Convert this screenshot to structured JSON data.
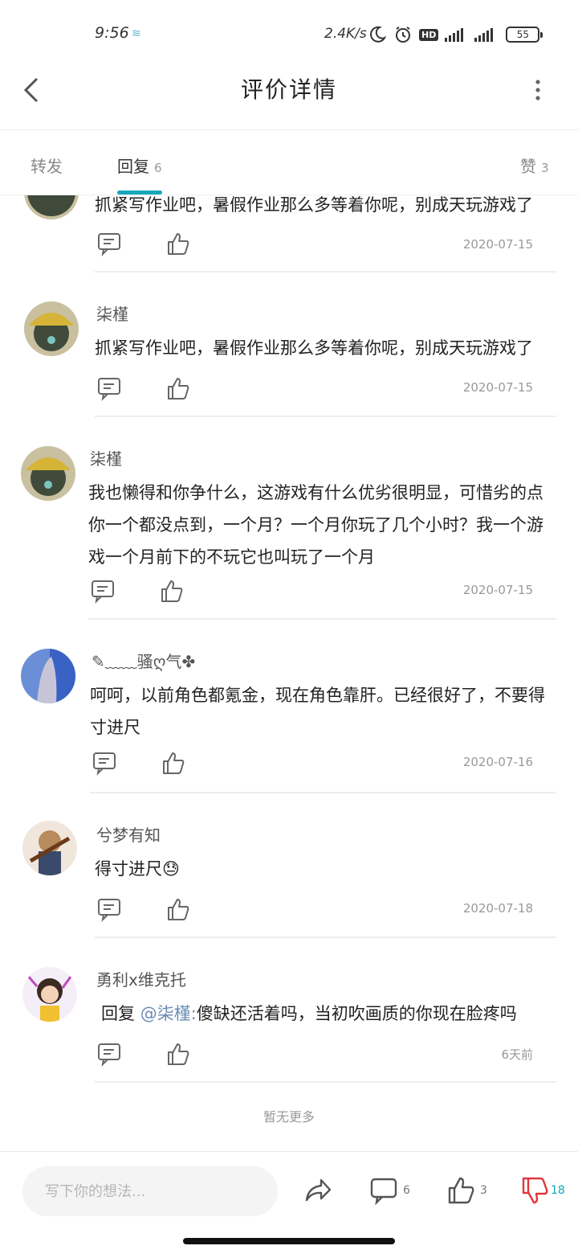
{
  "status_bar": {
    "time": "9:56",
    "net_speed": "2.4K/s",
    "hd": "HD",
    "battery": "55",
    "icons": [
      "wave-icon",
      "moon-icon",
      "alarm-icon",
      "hd-icon",
      "signal-icon",
      "signal-icon",
      "battery-icon"
    ]
  },
  "header": {
    "title": "评价详情",
    "back_icon": "chevron-left-icon",
    "more_icon": "more-vertical-icon"
  },
  "tabs": [
    {
      "label": "转发",
      "count": ""
    },
    {
      "label": "回复",
      "count": "6"
    },
    {
      "label": "赞",
      "count": "3"
    }
  ],
  "active_tab": 1,
  "replies": [
    {
      "user": "",
      "text": "抓紧写作业吧，暑假作业那么多等着你呢，别成天玩游戏了",
      "date": "2020-07-15",
      "mention": "",
      "prefix": ""
    },
    {
      "user": "柒槿",
      "text": "抓紧写作业吧，暑假作业那么多等着你呢，别成天玩游戏了",
      "date": "2020-07-15",
      "mention": "",
      "prefix": ""
    },
    {
      "user": "柒槿",
      "text": "我也懒得和你争什么，这游戏有什么优劣很明显，可惜劣的点你一个都没点到，一个月？一个月你玩了几个小时？我一个游戏一个月前下的不玩它也叫玩了一个月",
      "date": "2020-07-15",
      "mention": "",
      "prefix": ""
    },
    {
      "user": "✎﹏﹏骚ღ气✤",
      "text": "呵呵，以前角色都氪金，现在角色靠肝。已经很好了，不要得寸进尺",
      "date": "2020-07-16",
      "mention": "",
      "prefix": ""
    },
    {
      "user": "兮梦有知",
      "text": "得寸进尺😓",
      "date": "2020-07-18",
      "mention": "",
      "prefix": ""
    },
    {
      "user": "勇利x维克托",
      "text": "傻缺还活着吗，当初吹画质的你现在脸疼吗",
      "date": "6天前",
      "mention": "@柒槿:",
      "prefix": "回复 "
    }
  ],
  "footer_note": "暂无更多",
  "bottom_bar": {
    "input_placeholder": "写下你的想法...",
    "comment_count": "6",
    "like_count": "3",
    "dislike_count": "18",
    "dislike_color": "#e0363c",
    "accent_color": "#14a7b9"
  }
}
